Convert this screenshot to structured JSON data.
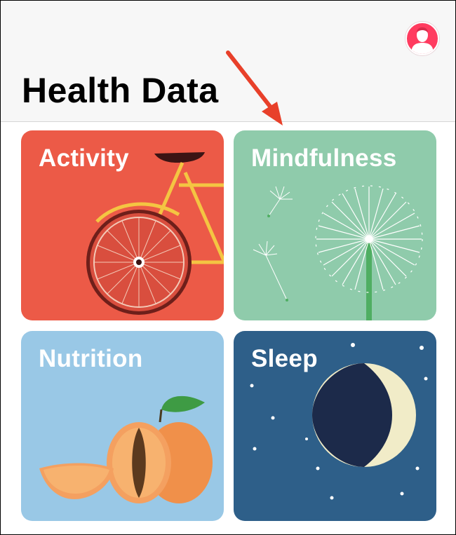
{
  "header": {
    "title": "Health Data",
    "profile_icon": "person-silhouette-icon"
  },
  "annotation": {
    "arrow_color": "#e8402a",
    "points_to": "mindfulness"
  },
  "categories": [
    {
      "id": "activity",
      "label": "Activity",
      "color": "#ec5a47",
      "icon": "bicycle-icon"
    },
    {
      "id": "mindfulness",
      "label": "Mindfulness",
      "color": "#8fcbab",
      "icon": "dandelion-icon"
    },
    {
      "id": "nutrition",
      "label": "Nutrition",
      "color": "#99c8e6",
      "icon": "peach-icon"
    },
    {
      "id": "sleep",
      "label": "Sleep",
      "color": "#2e5f89",
      "icon": "moon-icon"
    }
  ]
}
